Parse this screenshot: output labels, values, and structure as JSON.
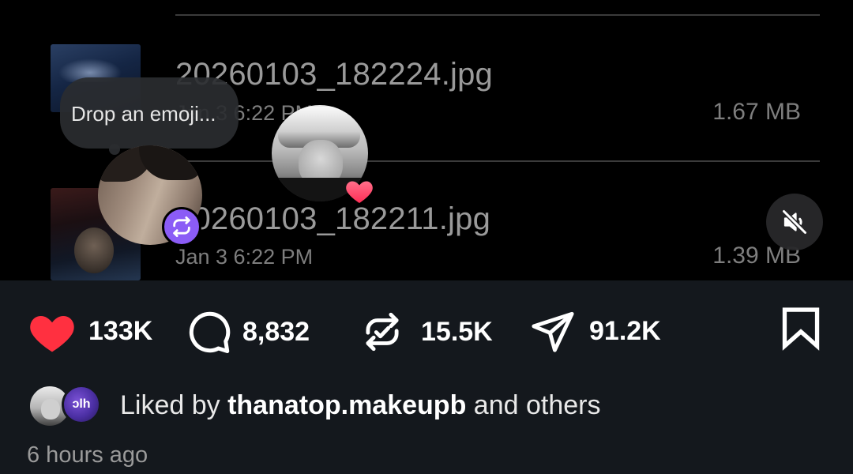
{
  "files": [
    {
      "name": "20260103_182224.jpg",
      "date": "Jan 3 6:22 PM",
      "size": "1.67 MB"
    },
    {
      "name": "20260103_182211.jpg",
      "date": "Jan 3 6:22 PM",
      "size": "1.39 MB"
    }
  ],
  "emoji_prompt": "Drop an emoji...",
  "actions": {
    "likes": "133K",
    "comments": "8,832",
    "reposts": "15.5K",
    "shares": "91.2K"
  },
  "liked_by": {
    "prefix": "Liked by",
    "user": "thanatop.makeupb",
    "suffix": "and others",
    "avatar_badge_text": "ɔlh"
  },
  "timestamp": "6 hours ago",
  "colors": {
    "like_red": "#ff3040",
    "repost_badge": "#8b5cf6",
    "panel_bg": "#14181d"
  },
  "icons": [
    "heart-icon",
    "comment-icon",
    "repost-icon",
    "share-icon",
    "bookmark-icon",
    "mute-icon"
  ]
}
